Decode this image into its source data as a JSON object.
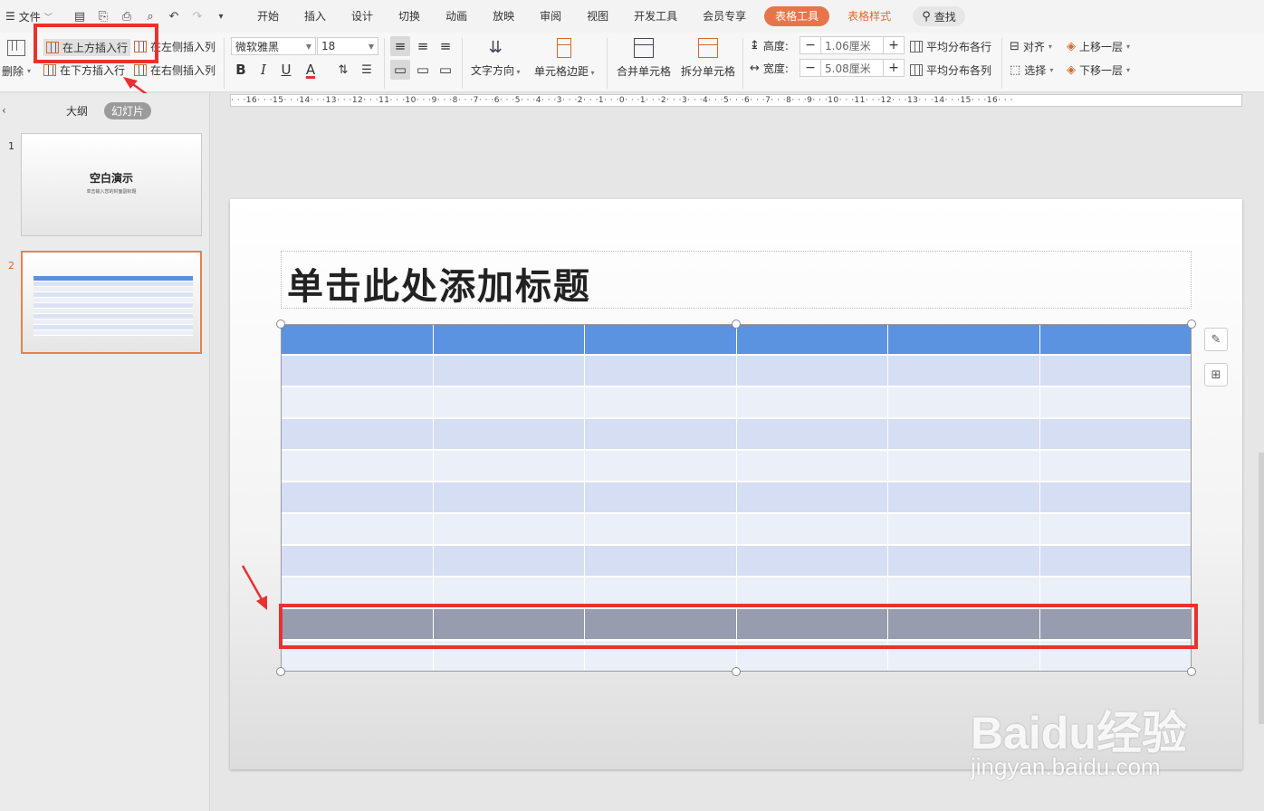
{
  "menu": {
    "file": "文件"
  },
  "tabs": [
    "开始",
    "插入",
    "设计",
    "切换",
    "动画",
    "放映",
    "审阅",
    "视图",
    "开发工具",
    "会员专享"
  ],
  "context_tabs": {
    "table_tools": "表格工具",
    "table_style": "表格样式"
  },
  "search": "查找",
  "ribbon": {
    "delete": "删除",
    "insert_above": "在上方插入行",
    "insert_below": "在下方插入行",
    "insert_left": "在左侧插入列",
    "insert_right": "在右侧插入列",
    "font": "微软雅黑",
    "size": "18",
    "text_direction": "文字方向",
    "cell_margin": "单元格边距",
    "merge": "合并单元格",
    "split": "拆分单元格",
    "height_label": "高度:",
    "height_value": "1.06厘米",
    "width_label": "宽度:",
    "width_value": "5.08厘米",
    "distribute_rows": "平均分布各行",
    "distribute_cols": "平均分布各列",
    "align": "对齐",
    "select": "选择",
    "bring_forward": "上移一层",
    "send_backward": "下移一层"
  },
  "panel": {
    "outline_tab": "大纲",
    "slides_tab": "幻灯片",
    "slides": [
      {
        "number": "1",
        "title": "空白演示",
        "subtitle": "单击输入您的封面副标题"
      },
      {
        "number": "2"
      }
    ]
  },
  "ruler": "· · ·16· · ·15· · ·14· · ·13· · ·12· · ·11· · ·10· · ·9· · ·8· · ·7· · ·6· · ·5· · ·4· · ·3· · ·2· · ·1· · ·0· · ·1· · ·2· · ·3· · ·4· · ·5· · ·6· · ·7· · ·8· · ·9· · ·10· · ·11· · ·12· · ·13· · ·14· · ·15· · ·16· · ·",
  "slide": {
    "title_placeholder": "单击此处添加标题"
  },
  "table": {
    "columns": 6,
    "rows": 11,
    "header_color": "#5b93e0",
    "band_color": "#d5def3",
    "alt_color": "#ebeff8",
    "selected_color": "#979cae",
    "selected_row": 10
  },
  "colors": {
    "accent": "#e8744a",
    "highlight": "#e83131"
  },
  "watermark": {
    "logo": "Baidu经验",
    "url": "jingyan.baidu.com"
  }
}
